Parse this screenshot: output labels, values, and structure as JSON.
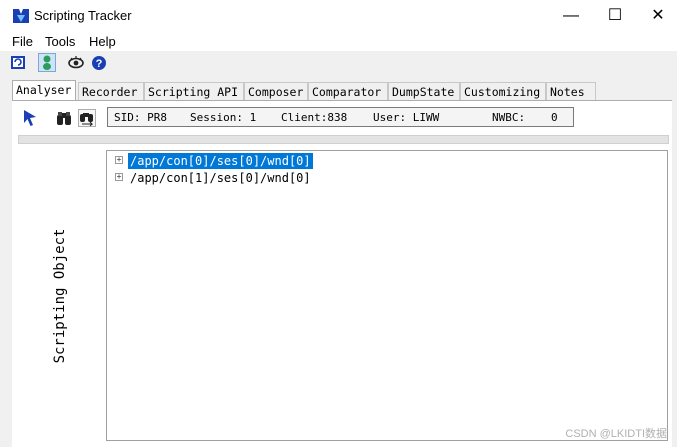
{
  "window": {
    "title": "Scripting Tracker",
    "minimize_glyph": "—",
    "maximize_glyph": "☐",
    "close_glyph": "✕"
  },
  "menu": [
    "File",
    "Tools",
    "Help"
  ],
  "toolbar": {
    "icons": [
      "refresh-icon",
      "person-icon",
      "eye-icon",
      "help-icon"
    ]
  },
  "tabs": [
    {
      "label": "Analyser",
      "active": true
    },
    {
      "label": "Recorder",
      "active": false
    },
    {
      "label": "Scripting API",
      "active": false
    },
    {
      "label": "Composer",
      "active": false
    },
    {
      "label": "Comparator",
      "active": false
    },
    {
      "label": "DumpState",
      "active": false
    },
    {
      "label": "Customizing",
      "active": false
    },
    {
      "label": "Notes",
      "active": false
    }
  ],
  "session_info": {
    "sid": "SID: PR8",
    "session": "Session: 1",
    "client": "Client:838",
    "user": "User: LIWW",
    "nwbc_label": "NWBC:",
    "nwbc_value": "0"
  },
  "side_label": "Scripting Object",
  "tree": [
    {
      "path": "/app/con[0]/ses[0]/wnd[0]",
      "selected": true
    },
    {
      "path": "/app/con[1]/ses[0]/wnd[0]",
      "selected": false
    }
  ],
  "watermark": "CSDN @LKIDTI数据",
  "colors": {
    "selection": "#0078d7",
    "accent_icon": "#1a3fb5",
    "person_icon": "#2a9d5c"
  }
}
